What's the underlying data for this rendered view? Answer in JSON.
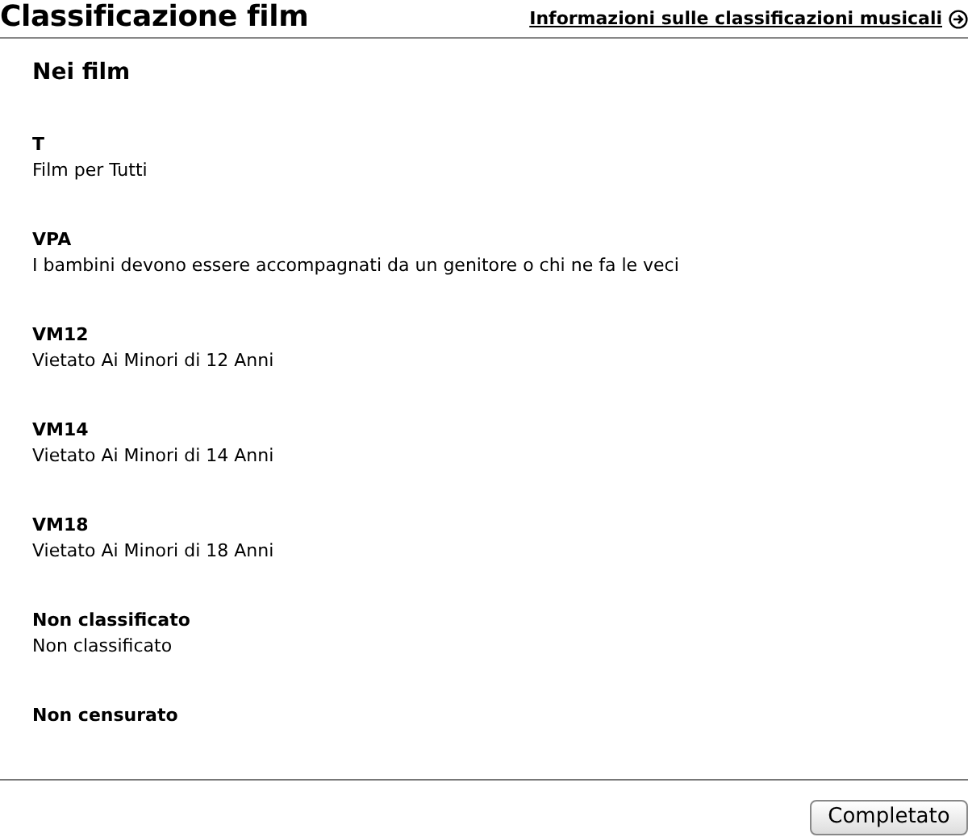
{
  "title": "Classificazione film",
  "info_link": {
    "label": "Informazioni sulle classificazioni musicali"
  },
  "section": {
    "heading": "Nei film",
    "ratings": [
      {
        "code": "T",
        "description": "Film per Tutti"
      },
      {
        "code": "VPA",
        "description": "I bambini devono essere accompagnati da un genitore o chi ne fa le veci"
      },
      {
        "code": "VM12",
        "description": "Vietato Ai Minori di 12 Anni"
      },
      {
        "code": "VM14",
        "description": "Vietato Ai Minori di 14 Anni"
      },
      {
        "code": "VM18",
        "description": "Vietato Ai Minori di 18 Anni"
      },
      {
        "code": "Non classificato",
        "description": "Non classificato"
      },
      {
        "code": "Non censurato"
      }
    ]
  },
  "buttons": [
    "Completato"
  ]
}
